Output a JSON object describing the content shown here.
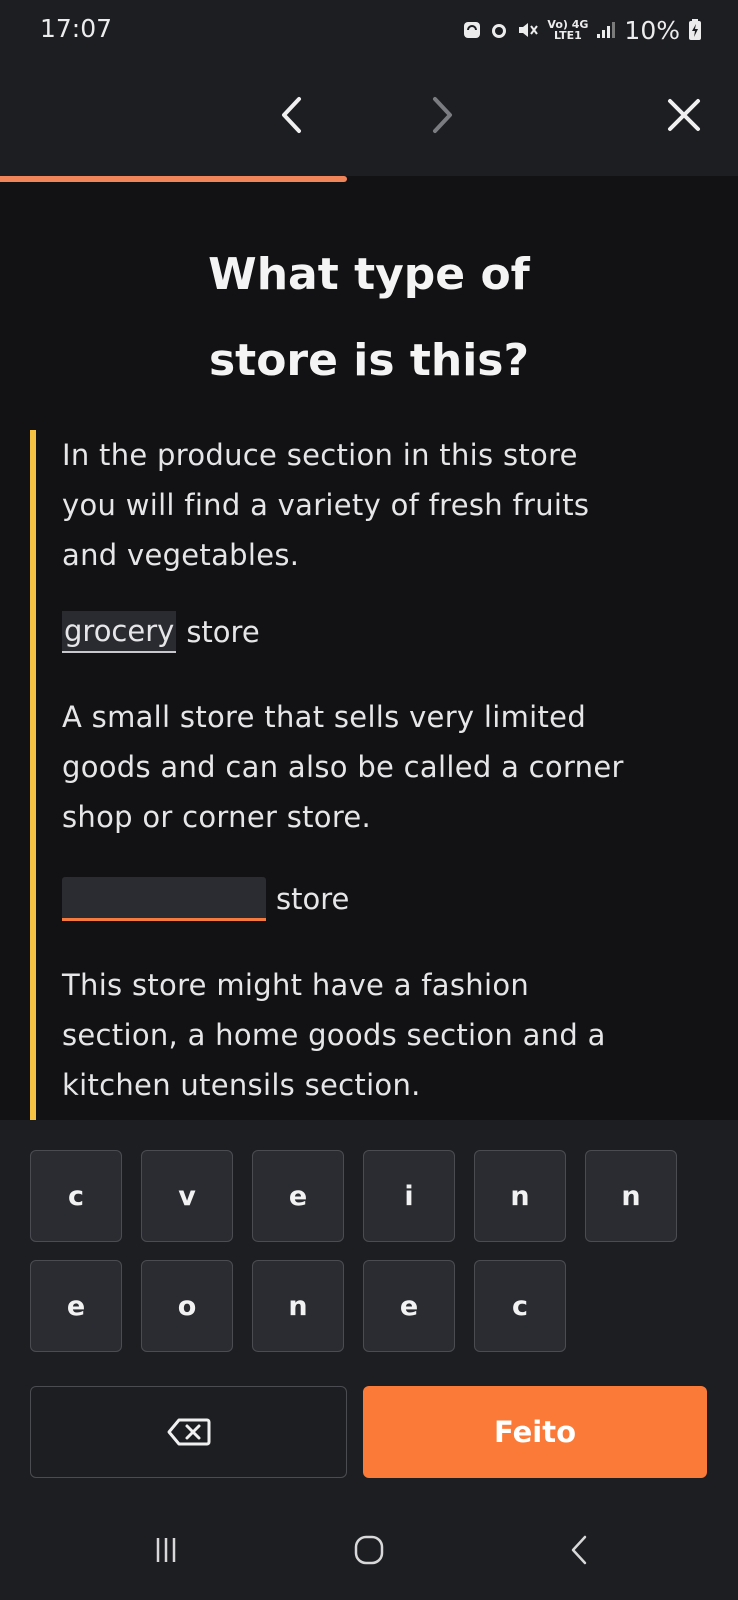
{
  "status_bar": {
    "time": "17:07",
    "network_top": "Vo) 4G",
    "network_bottom": "LTE1",
    "battery": "10%"
  },
  "nav": {
    "prev_icon": "chevron-left-icon",
    "next_icon": "chevron-right-icon",
    "close_icon": "close-icon"
  },
  "progress": {
    "fraction": 0.47,
    "color": "#f0855a"
  },
  "question": {
    "title_line1": "What type of",
    "title_line2": "store is this?"
  },
  "items": [
    {
      "description_lines": [
        "In the produce section in this store",
        "you will find a variety of fresh fruits",
        "and vegetables."
      ],
      "answer": "grocery",
      "suffix": "store"
    },
    {
      "description_lines": [
        "A small store that sells very limited",
        "goods and can also be called a corner",
        "shop or corner store."
      ],
      "answer": "",
      "suffix": "store"
    },
    {
      "description_lines": [
        "This store might have a fashion",
        "section, a home goods section and a",
        "kitchen utensils section."
      ]
    }
  ],
  "keyboard": {
    "row1": [
      "c",
      "v",
      "e",
      "i",
      "n",
      "n"
    ],
    "row2": [
      "e",
      "o",
      "n",
      "e",
      "c"
    ]
  },
  "actions": {
    "delete_icon": "backspace-icon",
    "done_label": "Feito"
  },
  "colors": {
    "accent": "#fb7a37",
    "highlight_bar": "#f5c244",
    "background": "#121215"
  }
}
